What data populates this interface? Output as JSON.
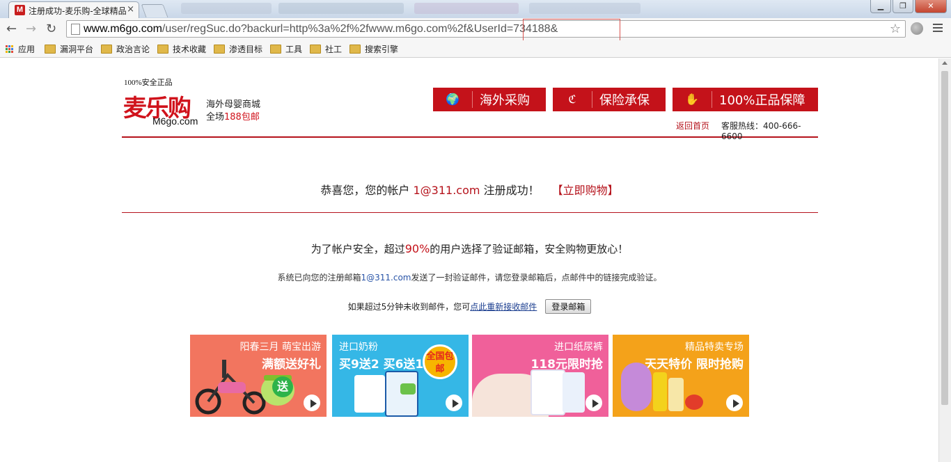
{
  "browser": {
    "tab_title": "注册成功-麦乐购-全球精品",
    "tab_favicon": "M",
    "tab_close": "×",
    "url_prefix": "www.m6go.com",
    "url_path": "/user/regSuc.do?backurl=http%3a%2f%2fwww.m6go.com%2f&UserId=734188&",
    "window_buttons": [
      "▁",
      "❐",
      "✕"
    ]
  },
  "bookmarks": [
    "应用",
    "漏洞平台",
    "政治言论",
    "技术收藏",
    "渗透目标",
    "工具",
    "社工",
    "搜索引擎"
  ],
  "header": {
    "slogan_small": "100%安全正品",
    "logo_text": "麦乐购",
    "logo_domain": "M6go.com",
    "tag1": "海外母婴商城",
    "tag2_prefix": "全场",
    "tag2_red": "188包邮",
    "badges": [
      {
        "icon": "world-map-icon",
        "glyph": "🌍",
        "label": "海外采购"
      },
      {
        "icon": "insurance-icon",
        "glyph": "ℭ",
        "label": "保险承保"
      },
      {
        "icon": "genuine-hand-icon",
        "glyph": "✋",
        "label": "100%正品保障"
      }
    ],
    "home_link": "返回首页",
    "hotline": "客服热线：400-666-6600"
  },
  "main": {
    "success_prefix": "恭喜您，您的帐户 ",
    "account": "1@311.com",
    "success_suffix": " 注册成功！",
    "shop_now": "【立即购物】",
    "safety_prefix": "为了帐户安全，超过",
    "safety_pct": "90%",
    "safety_suffix": "的用户选择了验证邮箱，安全购物更放心！",
    "sent_prefix": "系统已向您的注册邮箱",
    "sent_email": "1@311.com",
    "sent_suffix": "发送了一封验证邮件，请您登录邮箱后，点邮件中的链接完成验证。",
    "resend_prefix": "如果超过5分钟未收到邮件，您可",
    "resend_link": "点此重新接收邮件",
    "login_button": "登录邮箱"
  },
  "promos": [
    {
      "line1": "阳春三月  萌宝出游",
      "line2": "满额送好礼",
      "bg": "#f2755f"
    },
    {
      "line1": "进口奶粉",
      "line2": "买9送2 买6送1",
      "badge": "全国包邮",
      "bg": "#35b7e6"
    },
    {
      "line1": "进口纸尿裤",
      "line2": "118元限时抢",
      "bg": "#f0609a"
    },
    {
      "line1": "精品特卖专场",
      "line2": "天天特价 限时抢购",
      "bg": "#f4a21a"
    }
  ]
}
